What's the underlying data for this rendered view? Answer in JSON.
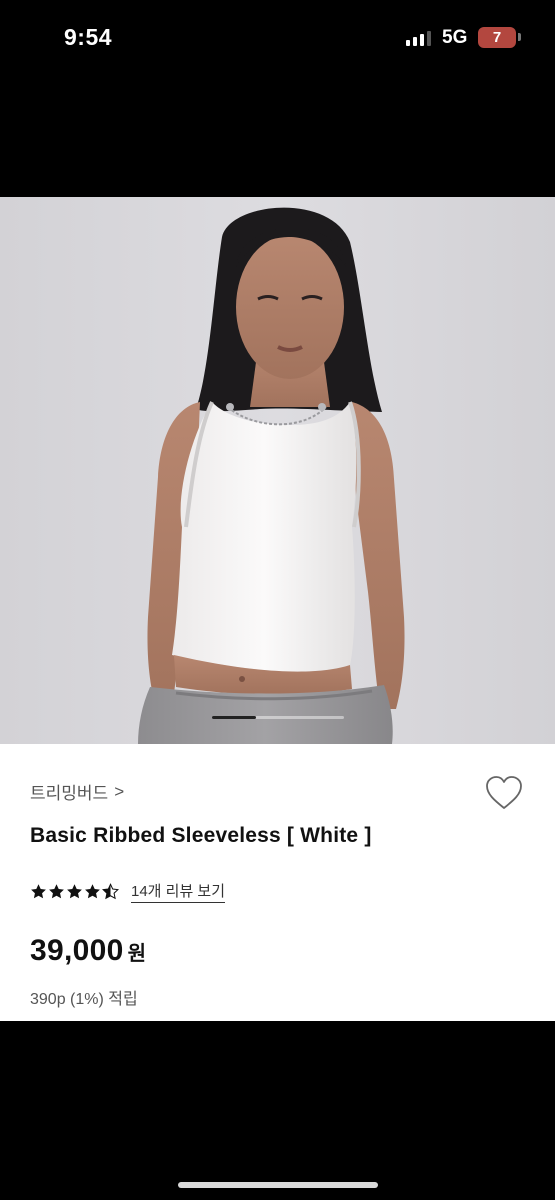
{
  "status_bar": {
    "time": "9:54",
    "network": "5G",
    "battery": "7",
    "battery_color": "#b3473f"
  },
  "product": {
    "image_alt": "model wearing white ribbed sleeveless top",
    "photo_progress": 0.33,
    "brand": "트리밍버드",
    "brand_chevron": ">",
    "name": "Basic Ribbed Sleeveless [ White ]",
    "rating": 4.5,
    "review_link": "14개 리뷰 보기",
    "price": "39,000",
    "currency": "원",
    "points": "390p (1%) 적립",
    "favorite_icon": "heart-outline-icon"
  }
}
